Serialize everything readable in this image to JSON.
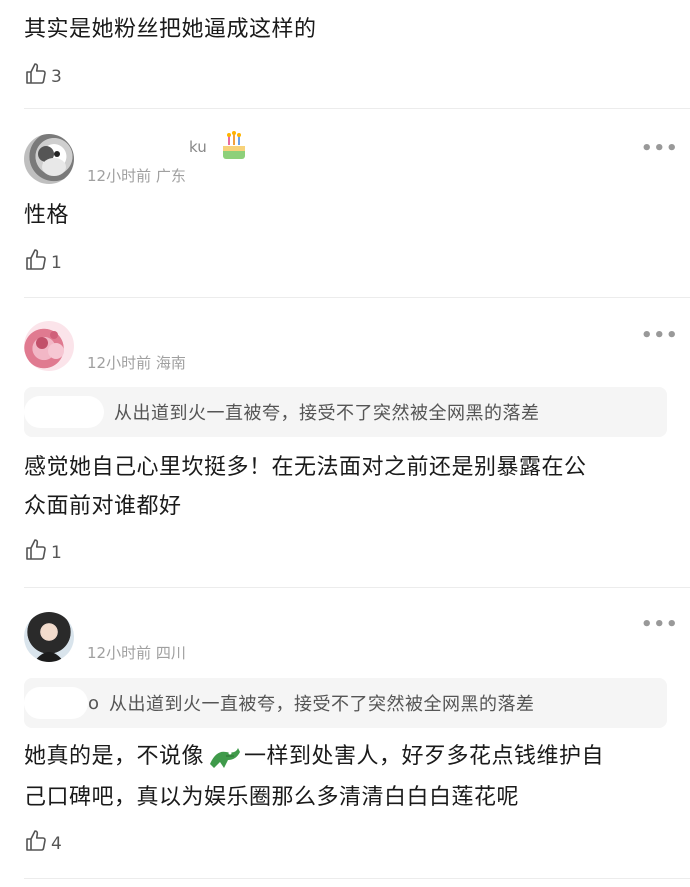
{
  "comments": [
    {
      "text": "其实是她粉丝把她逼成这样的",
      "likes": "3"
    },
    {
      "name_partial": "ku",
      "time": "12小时前",
      "region": "广东",
      "text": "性格",
      "likes": "1"
    },
    {
      "time": "12小时前",
      "region": "海南",
      "quote": "从出道到火一直被夸，接受不了突然被全网黑的落差",
      "text_line1": "感觉她自己心里坎挺多！在无法面对之前还是别暴露在公",
      "text_line2": "众面前对谁都好",
      "likes": "1"
    },
    {
      "time": "12小时前",
      "region": "四川",
      "quote_prefix": "o",
      "quote": "从出道到火一直被夸，接受不了突然被全网黑的落差",
      "text_line1_a": "她真的是，不说像",
      "text_line1_b": "一样到处害人，好歹多花点钱维护自",
      "text_line2": "己口碑吧，真以为娱乐圈那么多清清白白白莲花呢",
      "likes": "4"
    }
  ],
  "more_glyph": "•••",
  "icons": {
    "like": "thumbs-up-icon",
    "more": "more-dots-icon",
    "cake": "cake-badge-icon",
    "crocodile": "crocodile-emoji-icon"
  }
}
